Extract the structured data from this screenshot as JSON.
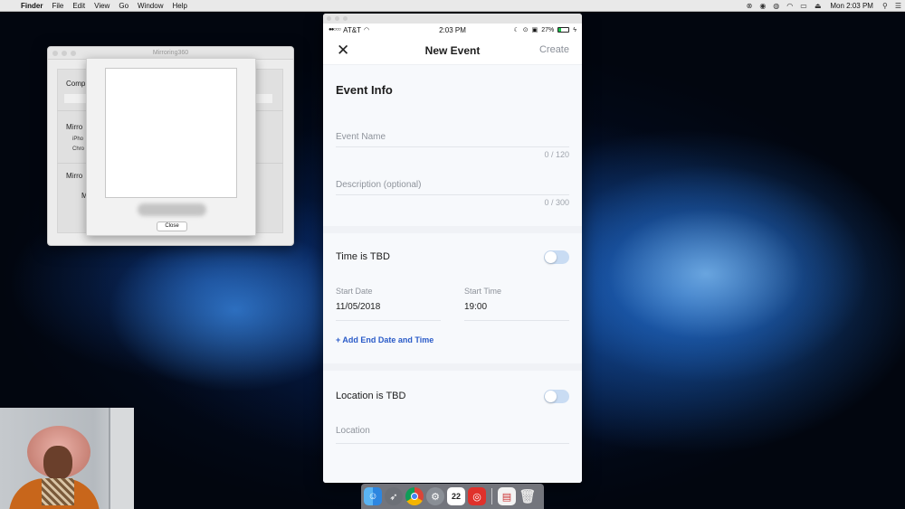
{
  "menubar": {
    "apple_glyph": "",
    "items": [
      "Finder",
      "File",
      "Edit",
      "View",
      "Go",
      "Window",
      "Help"
    ],
    "clock": "Mon 2:03 PM"
  },
  "mirroring_window": {
    "title": "Mirroring360",
    "labels": [
      "Comp",
      "Mirro",
      "iPho",
      "Chro",
      "Mirro",
      "M"
    ],
    "close_label": "Close"
  },
  "phone": {
    "status": {
      "carrier": "AT&T",
      "time": "2:03 PM",
      "battery": "27%",
      "battery_level": 0.27
    },
    "nav": {
      "title": "New Event",
      "create_label": "Create",
      "close_glyph": "✕"
    },
    "section_title": "Event Info",
    "event_name": {
      "placeholder": "Event Name",
      "counter": "0 / 120"
    },
    "description": {
      "placeholder": "Description (optional)",
      "counter": "0 / 300"
    },
    "time_tbd": {
      "label": "Time is TBD"
    },
    "start_date": {
      "label": "Start Date",
      "value": "11/05/2018"
    },
    "start_time": {
      "label": "Start Time",
      "value": "19:00"
    },
    "add_end_label": "+ Add End Date and Time",
    "location_tbd": {
      "label": "Location is TBD"
    },
    "location": {
      "placeholder": "Location"
    }
  },
  "dock": {
    "icons": [
      "finder-icon",
      "launchpad-icon",
      "chrome-icon",
      "system-preferences-icon",
      "calendar-icon",
      "mirroring360-icon",
      "preview-icon",
      "trash-icon"
    ],
    "calendar_day": "22"
  },
  "colors": {
    "accent_blue": "#2a5bc8",
    "toggle_off": "#c9dcf3",
    "battery_green": "#19c44b"
  }
}
